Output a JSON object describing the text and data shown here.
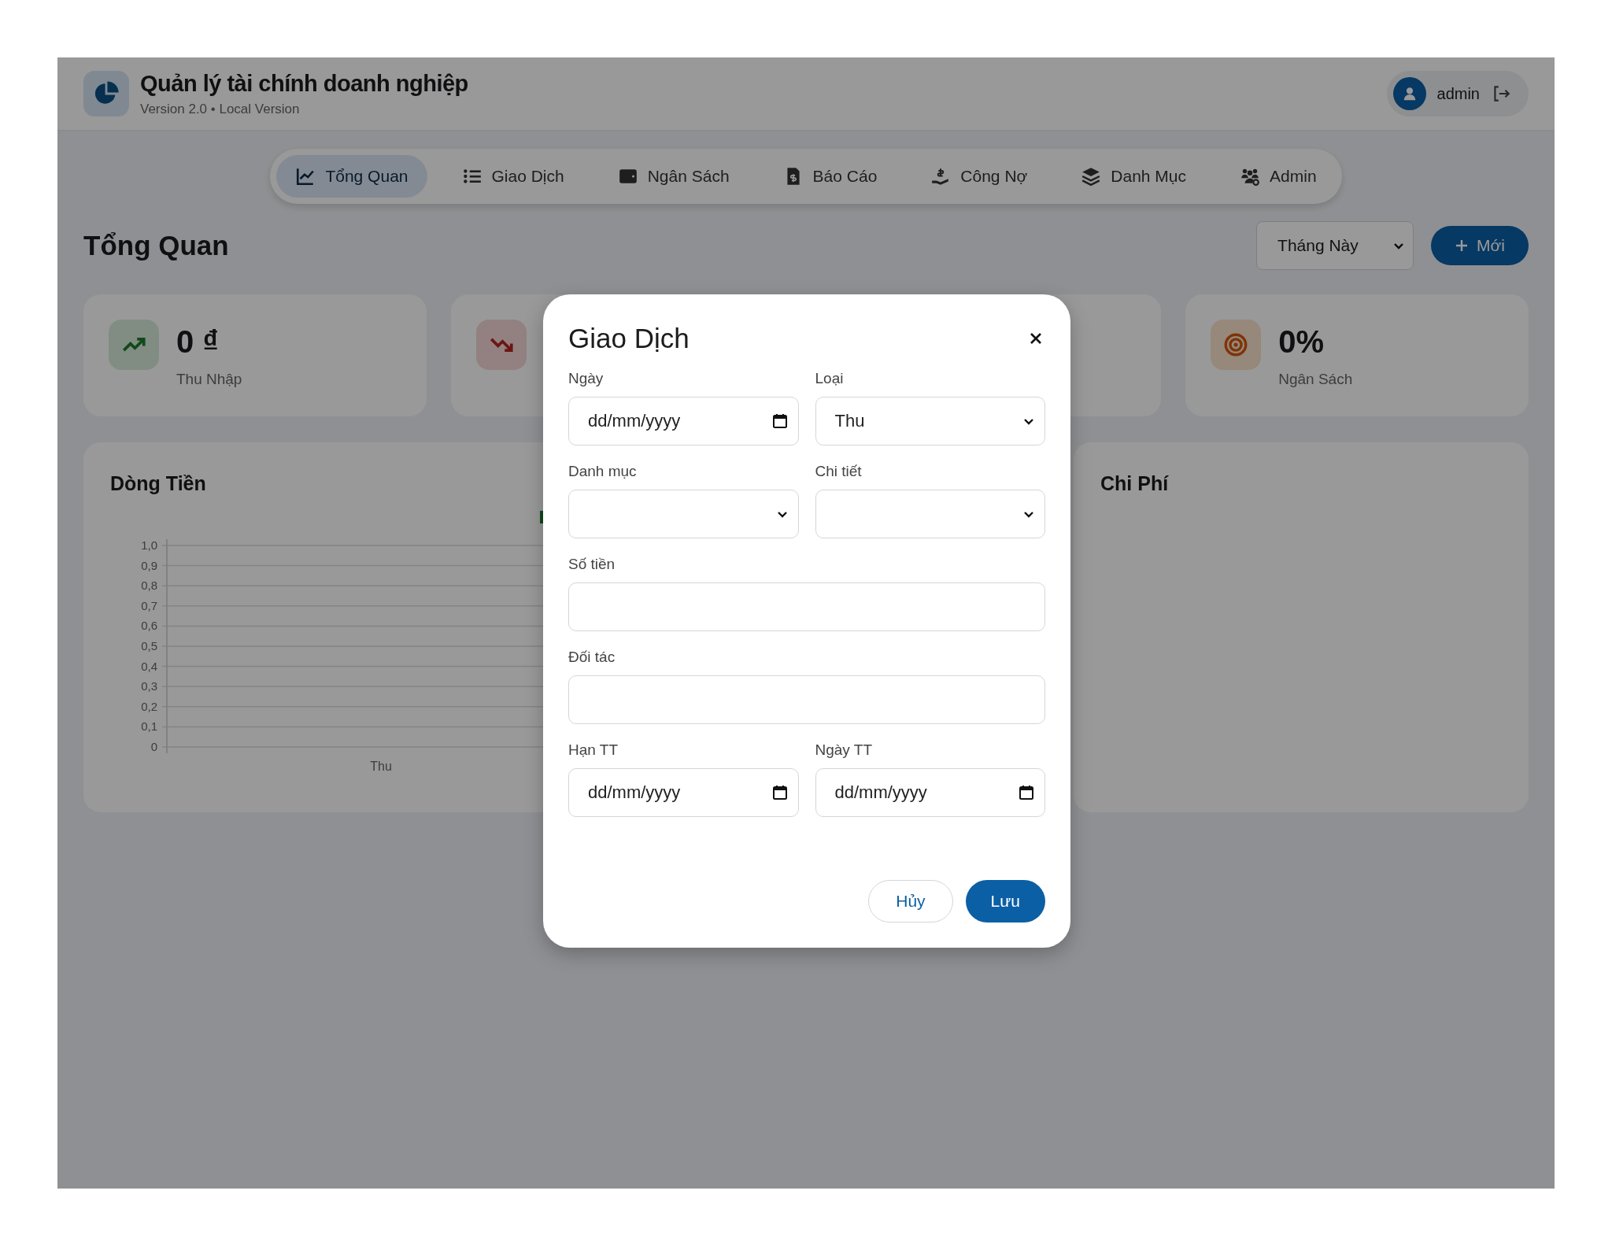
{
  "header": {
    "title": "Quản lý tài chính doanh nghiệp",
    "subtitle": "Version 2.0 • Local Version",
    "user": "admin"
  },
  "nav": [
    {
      "label": "Tổng Quan",
      "kind": "chart",
      "selected": true
    },
    {
      "label": "Giao Dịch",
      "kind": "list",
      "selected": false
    },
    {
      "label": "Ngân Sách",
      "kind": "wallet",
      "selected": false
    },
    {
      "label": "Báo Cáo",
      "kind": "invoice",
      "selected": false
    },
    {
      "label": "Công Nợ",
      "kind": "loan",
      "selected": false
    },
    {
      "label": "Danh Mục",
      "kind": "layers",
      "selected": false
    },
    {
      "label": "Admin",
      "kind": "users",
      "selected": false
    }
  ],
  "page": {
    "title": "Tổng Quan",
    "period": "Tháng Này",
    "new_button": "Mới"
  },
  "stats": [
    {
      "kind": "income",
      "value": "0 ₫",
      "label": "Thu Nhập"
    },
    {
      "kind": "expense"
    },
    {
      "kind": "blank"
    },
    {
      "kind": "budget",
      "value": "0%",
      "label": "Ngân Sách"
    }
  ],
  "panels": [
    {
      "title": "Dòng Tiền",
      "chart_data": {
        "type": "bar",
        "grid": true,
        "categories": [
          "Thu"
        ],
        "series": [
          {
            "color": "#1e7a2e",
            "values": [
              0
            ]
          }
        ],
        "ylim": [
          0,
          1
        ],
        "yticks": [
          {
            "value": 0,
            "label": "0"
          },
          {
            "value": 0.1,
            "label": "0,1"
          },
          {
            "value": 0.2,
            "label": "0,2"
          },
          {
            "value": 0.3,
            "label": "0,3"
          },
          {
            "value": 0.4,
            "label": "0,4"
          },
          {
            "value": 0.5,
            "label": "0,5"
          },
          {
            "value": 0.6,
            "label": "0,6"
          },
          {
            "value": 0.7,
            "label": "0,7"
          },
          {
            "value": 0.8,
            "label": "0,8"
          },
          {
            "value": 0.9,
            "label": "0,9"
          },
          {
            "value": 1,
            "label": "1,0"
          }
        ]
      }
    },
    {
      "title": "Chi Phí"
    }
  ],
  "dialog": {
    "title": "Giao Dịch",
    "rows": [
      {
        "fields": [
          {
            "label": "Ngày",
            "kind": "date",
            "placeholder": "dd/mm/yyyy"
          },
          {
            "label": "Loại",
            "kind": "select",
            "value": "Thu"
          }
        ]
      },
      {
        "fields": [
          {
            "label": "Danh mục",
            "kind": "select"
          },
          {
            "label": "Chi tiết",
            "kind": "select"
          }
        ]
      },
      {
        "fields": [
          {
            "label": "Số tiền",
            "kind": "text"
          }
        ]
      },
      {
        "fields": [
          {
            "label": "Đối tác",
            "kind": "text"
          }
        ]
      },
      {
        "fields": [
          {
            "label": "Hạn TT",
            "kind": "date",
            "placeholder": "dd/mm/yyyy"
          },
          {
            "label": "Ngày TT",
            "kind": "date",
            "placeholder": "dd/mm/yyyy"
          }
        ]
      }
    ],
    "cancel": "Hủy",
    "save": "Lưu"
  }
}
